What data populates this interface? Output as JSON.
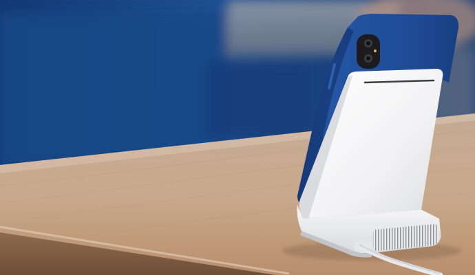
{
  "photo": {
    "subject": "phone-on-wireless-charging-stand",
    "colors": {
      "background_blue": "#1d4a8a",
      "background_dark_blue": "#0f2e5e",
      "wall_grey": "#b8bcc4",
      "table_wood": "#c9a98c",
      "table_wood_dark": "#a98568",
      "phone_case": "#1f4b96",
      "phone_case_shadow": "#163a78",
      "stand_white": "#f4f4f5",
      "stand_shadow": "#d6d7da",
      "camera_black": "#1c1c1e",
      "cable_white": "#e8e9ec"
    }
  }
}
